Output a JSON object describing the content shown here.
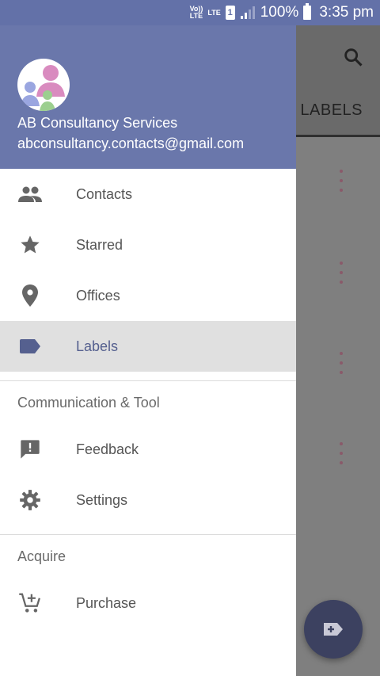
{
  "status_bar": {
    "volte": "Vo))\nLTE",
    "lte": "LTE",
    "sim": "1",
    "battery": "100%",
    "time": "3:35 pm"
  },
  "background": {
    "tab_label": "LABELS"
  },
  "drawer": {
    "account_name": "AB Consultancy Services",
    "account_email": "abconsultancy.contacts@gmail.com",
    "items": [
      {
        "label": "Contacts",
        "icon": "people-icon"
      },
      {
        "label": "Starred",
        "icon": "star-icon"
      },
      {
        "label": "Offices",
        "icon": "location-pin-icon"
      },
      {
        "label": "Labels",
        "icon": "label-icon",
        "active": true
      }
    ],
    "section_communication": "Communication & Tool",
    "comm_items": [
      {
        "label": "Feedback",
        "icon": "feedback-icon"
      },
      {
        "label": "Settings",
        "icon": "gear-icon"
      }
    ],
    "section_acquire": "Acquire",
    "acquire_items": [
      {
        "label": "Purchase",
        "icon": "cart-add-icon"
      }
    ]
  },
  "colors": {
    "header": "#6a77ab",
    "status_bar": "#6371a8",
    "active_item_bg": "#e0e0e0",
    "active_item_text": "#55608f"
  }
}
